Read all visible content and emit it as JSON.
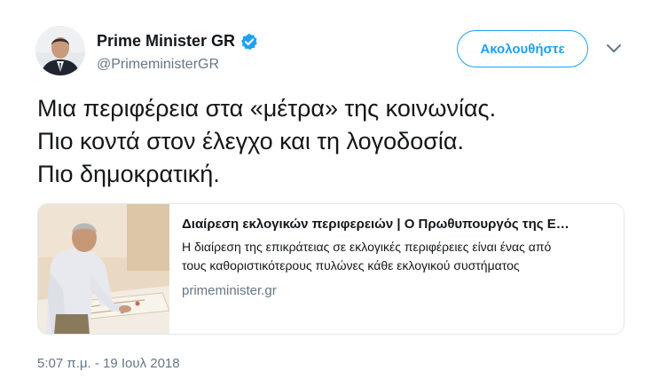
{
  "author": {
    "display_name": "Prime Minister GR",
    "handle": "@PrimeministerGR",
    "verified": true
  },
  "follow_button": {
    "label": "Ακολουθήστε"
  },
  "tweet": {
    "lines": [
      "Μια περιφέρεια στα «μέτρα» της κοινωνίας.",
      "Πιο κοντά στον έλεγχο και τη λογοδοσία.",
      "Πιο δημοκρατική."
    ]
  },
  "card": {
    "title": "Διαίρεση εκλογικών περιφερειών | Ο Πρωθυπουργός της Ε…",
    "description_lines": [
      "Η διαίρεση της επικράτειας σε εκλογικές περιφέρειες είναι ένας από",
      "τους καθοριστικότερους πυλώνες κάθε εκλογικού συστήματος"
    ],
    "domain": "primeminister.gr"
  },
  "timestamp": "5:07 π.μ. - 19 Ιουλ 2018",
  "colors": {
    "accent": "#1da1f2",
    "text": "#14171a",
    "secondary": "#657786",
    "border": "#e1e8ed"
  },
  "icons": [
    "verified-badge-icon",
    "chevron-down-icon"
  ]
}
